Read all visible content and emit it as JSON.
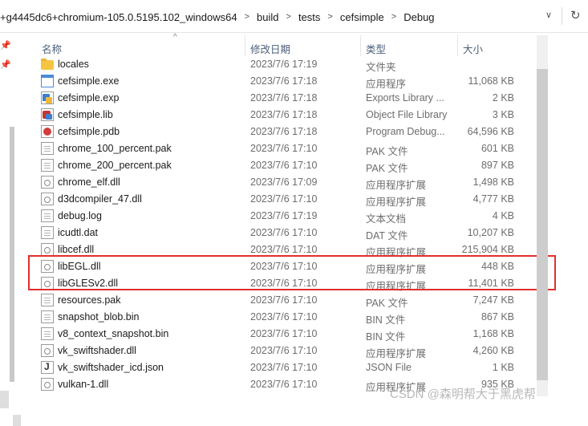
{
  "address_bar": {
    "crumbs": [
      "+g4445dc6+chromium-105.0.5195.102_windows64",
      "build",
      "tests",
      "cefsimple",
      "Debug"
    ],
    "separator": ">",
    "dropdown": "∨",
    "refresh": "↻"
  },
  "columns": {
    "name": "名称",
    "date": "修改日期",
    "type": "类型",
    "size": "大小"
  },
  "files": [
    {
      "name": "locales",
      "date": "2023/7/6 17:19",
      "type": "文件夹",
      "size": "",
      "icon": "folder-icon"
    },
    {
      "name": "cefsimple.exe",
      "date": "2023/7/6 17:18",
      "type": "应用程序",
      "size": "11,068 KB",
      "icon": "exe-icon"
    },
    {
      "name": "cefsimple.exp",
      "date": "2023/7/6 17:18",
      "type": "Exports Library ...",
      "size": "2 KB",
      "icon": "exp-icon"
    },
    {
      "name": "cefsimple.lib",
      "date": "2023/7/6 17:18",
      "type": "Object File Library",
      "size": "3 KB",
      "icon": "lib-icon"
    },
    {
      "name": "cefsimple.pdb",
      "date": "2023/7/6 17:18",
      "type": "Program Debug...",
      "size": "64,596 KB",
      "icon": "pdb-icon"
    },
    {
      "name": "chrome_100_percent.pak",
      "date": "2023/7/6 17:10",
      "type": "PAK 文件",
      "size": "601 KB",
      "icon": "file-icon"
    },
    {
      "name": "chrome_200_percent.pak",
      "date": "2023/7/6 17:10",
      "type": "PAK 文件",
      "size": "897 KB",
      "icon": "file-icon"
    },
    {
      "name": "chrome_elf.dll",
      "date": "2023/7/6 17:09",
      "type": "应用程序扩展",
      "size": "1,498 KB",
      "icon": "dll-icon"
    },
    {
      "name": "d3dcompiler_47.dll",
      "date": "2023/7/6 17:10",
      "type": "应用程序扩展",
      "size": "4,777 KB",
      "icon": "dll-icon"
    },
    {
      "name": "debug.log",
      "date": "2023/7/6 17:19",
      "type": "文本文档",
      "size": "4 KB",
      "icon": "text-file-icon"
    },
    {
      "name": "icudtl.dat",
      "date": "2023/7/6 17:10",
      "type": "DAT 文件",
      "size": "10,207 KB",
      "icon": "file-icon"
    },
    {
      "name": "libcef.dll",
      "date": "2023/7/6 17:10",
      "type": "应用程序扩展",
      "size": "215,904 KB",
      "icon": "dll-icon"
    },
    {
      "name": "libEGL.dll",
      "date": "2023/7/6 17:10",
      "type": "应用程序扩展",
      "size": "448 KB",
      "icon": "dll-icon"
    },
    {
      "name": "libGLESv2.dll",
      "date": "2023/7/6 17:10",
      "type": "应用程序扩展",
      "size": "11,401 KB",
      "icon": "dll-icon"
    },
    {
      "name": "resources.pak",
      "date": "2023/7/6 17:10",
      "type": "PAK 文件",
      "size": "7,247 KB",
      "icon": "file-icon"
    },
    {
      "name": "snapshot_blob.bin",
      "date": "2023/7/6 17:10",
      "type": "BIN 文件",
      "size": "867 KB",
      "icon": "file-icon"
    },
    {
      "name": "v8_context_snapshot.bin",
      "date": "2023/7/6 17:10",
      "type": "BIN 文件",
      "size": "1,168 KB",
      "icon": "file-icon"
    },
    {
      "name": "vk_swiftshader.dll",
      "date": "2023/7/6 17:10",
      "type": "应用程序扩展",
      "size": "4,260 KB",
      "icon": "dll-icon"
    },
    {
      "name": "vk_swiftshader_icd.json",
      "date": "2023/7/6 17:10",
      "type": "JSON File",
      "size": "1 KB",
      "icon": "json-icon"
    },
    {
      "name": "vulkan-1.dll",
      "date": "2023/7/6 17:10",
      "type": "应用程序扩展",
      "size": "935 KB",
      "icon": "dll-icon"
    }
  ],
  "highlight_color": "#e0302e",
  "watermark": "CSDN @森明帮大于黑虎帮"
}
